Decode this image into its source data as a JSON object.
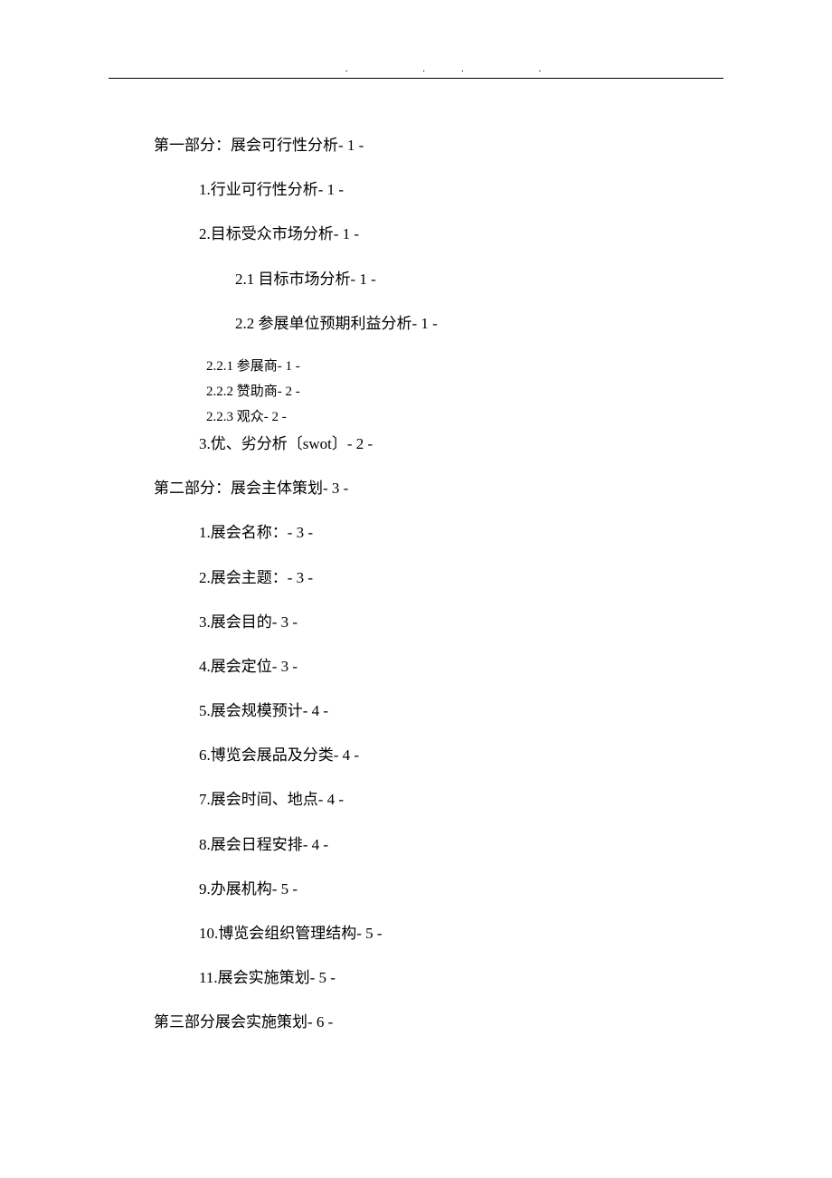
{
  "header_dots": ".          ..               .",
  "toc": {
    "part1": {
      "title": "第一部分：展会可行性分析- 1 -",
      "items": {
        "i1": "1.行业可行性分析- 1 -",
        "i2": "2.目标受众市场分析- 1 -",
        "i2_1": "2.1 目标市场分析- 1 -",
        "i2_2": "2.2 参展单位预期利益分析- 1 -",
        "i2_2_1": "2.2.1 参展商- 1 -",
        "i2_2_2": "2.2.2 赞助商- 2 -",
        "i2_2_3": "2.2.3 观众- 2 -",
        "i3": "3.优、劣分析〔swot〕- 2 -"
      }
    },
    "part2": {
      "title": "第二部分：展会主体策划- 3 -",
      "items": {
        "i1": "1.展会名称：- 3 -",
        "i2": "2.展会主题：- 3 -",
        "i3": "3.展会目的- 3 -",
        "i4": "4.展会定位- 3 -",
        "i5": "5.展会规模预计- 4 -",
        "i6": "6.博览会展品及分类- 4 -",
        "i7": "7.展会时间、地点- 4 -",
        "i8": "8.展会日程安排- 4 -",
        "i9": "9.办展机构- 5 -",
        "i10": "10.博览会组织管理结构- 5 -",
        "i11": "11.展会实施策划- 5 -"
      }
    },
    "part3": {
      "title": "第三部分展会实施策划- 6 -"
    }
  }
}
